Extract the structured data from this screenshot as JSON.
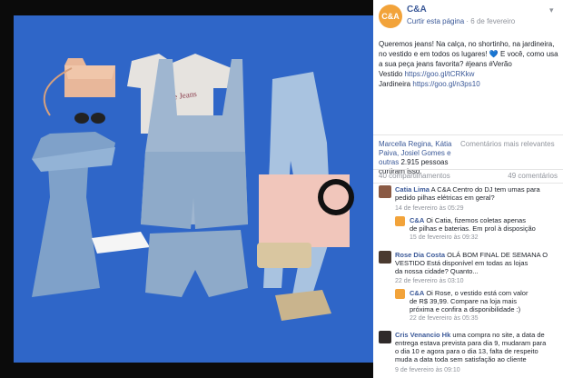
{
  "page": {
    "name": "C&A",
    "logo_text": "C&A",
    "follow": "Curtir esta página",
    "date": "6 de fevereiro"
  },
  "post": {
    "lines": [
      "Queremos jeans! Na calça, no shortinho, na jardineira,",
      "no vestido e em todos os lugares! 💙 E você, como usa",
      "a sua peça jeans favorita? #jeans #Verão"
    ],
    "vestido_label": "Vestido",
    "vestido_link": "https://goo.gl/tCRKkw",
    "jardineira_label": "Jardineira",
    "jardineira_link": "https://goo.gl/n3ps10"
  },
  "reactions": {
    "names": "Marcella Regina, Kátia Paiva, Josiel Gomes e outras",
    "count_text": "2.915 pessoas curtiram isso.",
    "sort": "Comentários mais relevantes"
  },
  "counts": {
    "shares": "40 compartilhamentos",
    "comments": "49 comentários"
  },
  "comments": [
    {
      "author": "Catia Lima",
      "text": "A C&A Centro do DJ tem umas para",
      "text2": "pedido pilhas elétricas em geral?",
      "time": "14 de fevereiro às 05:29"
    },
    {
      "author": "C&A",
      "text": "Oi Catia, fizemos coletas apenas",
      "text2": "de pilhas e baterias. Em prol à disposição",
      "time": "15 de fevereiro às 09:32",
      "reply": true
    },
    {
      "author": "Rose Dia Costa",
      "text": "OLÁ BOM FINAL DE SEMANA O",
      "text2": "VESTIDO Está disponível em todas as lojas",
      "text3": "da nossa cidade? Quanto...",
      "time": "22 de fevereiro às 03:10"
    },
    {
      "author": "C&A",
      "text": "Oi Rose, o vestido está com valor",
      "text2": "de R$ 39,99. Compare na loja mais",
      "text3": "próxima e confira a disponibilidade :)",
      "time": "22 de fevereiro às 05:35",
      "reply": true
    },
    {
      "author": "Cris Venancio Hk",
      "text": "uma compra no site, a data de",
      "text2": "entrega estava prevista para dia 9, mudaram para",
      "text3": "o dia 10 e agora para o dia 13, falta de respeito",
      "text4": "muda a data toda sem satisfação ao cliente",
      "time": "9 de fevereiro às 09:10"
    }
  ],
  "colors": {
    "photo_bg": "#2a63c4",
    "link": "#3b5998",
    "accent": "#f2a33a"
  }
}
